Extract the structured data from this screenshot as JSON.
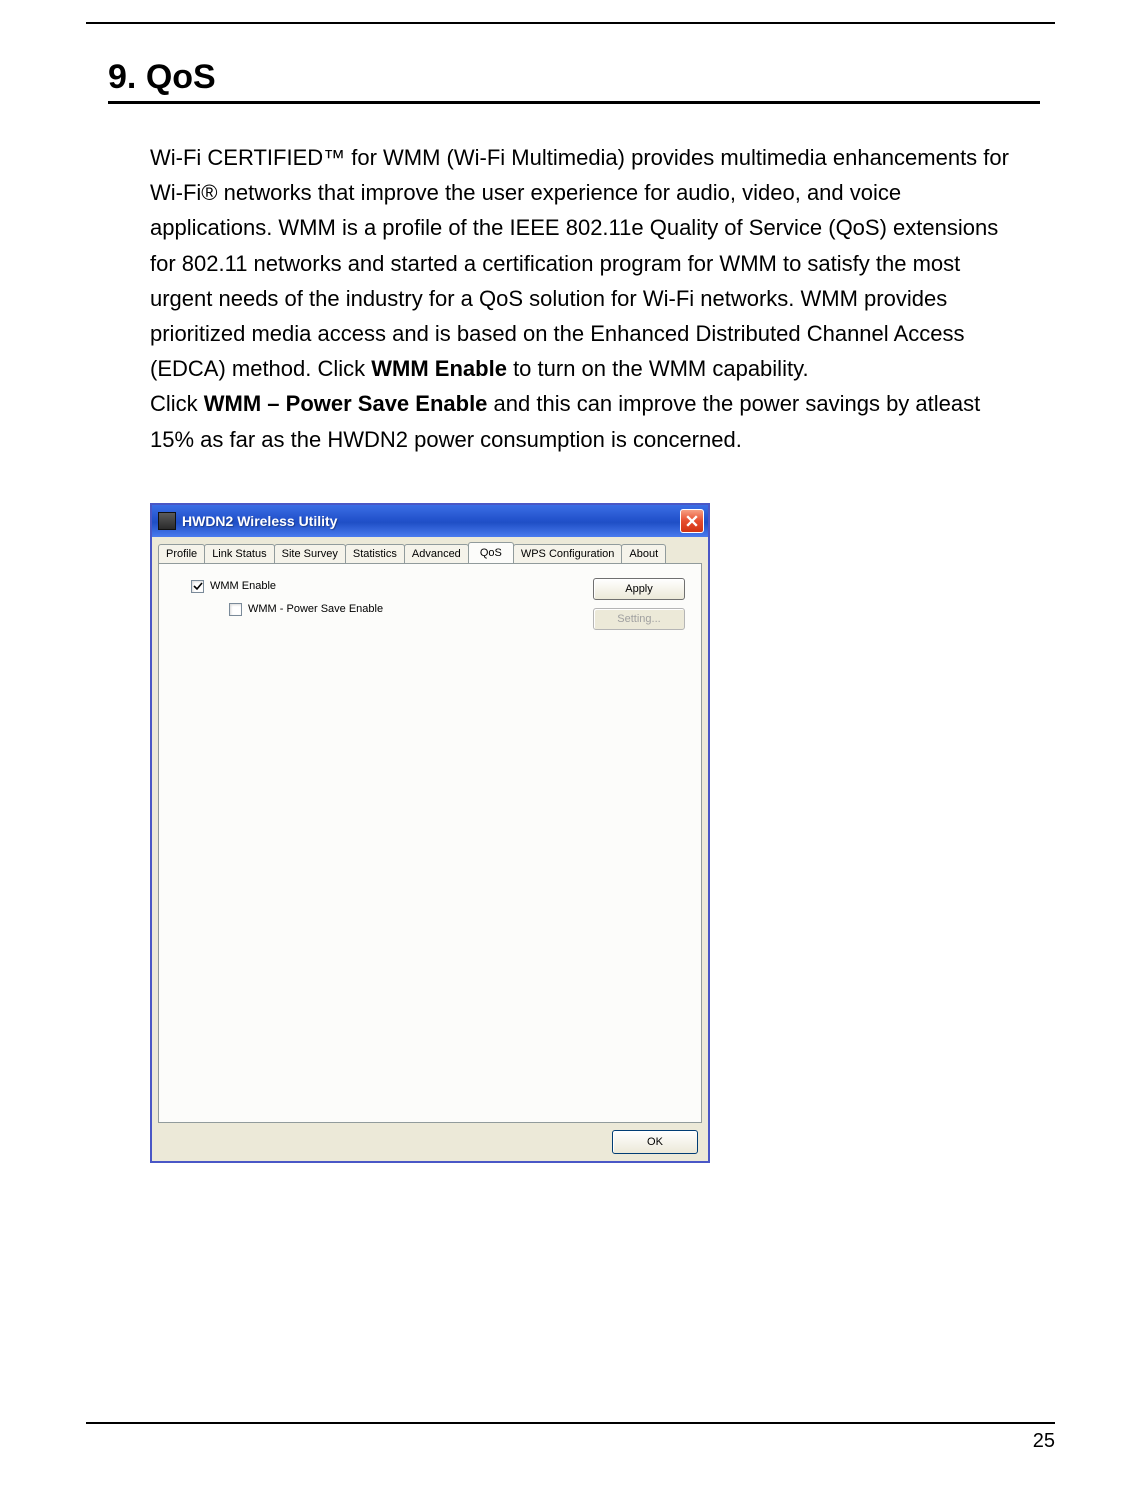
{
  "section": {
    "number": "9.",
    "title": "QoS"
  },
  "paragraphs": {
    "p1a": "Wi-Fi CERTIFIED™ for WMM (Wi-Fi Multimedia) provides multimedia enhancements for Wi-Fi® networks that improve the user experience for audio, video, and voice applications. WMM is a profile of the IEEE 802.11e Quality of Service (QoS) extensions for 802.11 networks and started a certification program for WMM to satisfy the most urgent needs of the industry for a QoS solution for Wi-Fi networks. WMM provides prioritized media access and is based on the Enhanced Distributed Channel Access (EDCA) method.   Click ",
    "p1bold1": "WMM Enable",
    "p1b": " to turn on the WMM capability.",
    "p2a": "Click ",
    "p2bold": "WMM – Power Save Enable",
    "p2b": " and this can improve the power savings by atleast 15% as far as the HWDN2  power consumption is concerned."
  },
  "dialog": {
    "title": "HWDN2 Wireless Utility",
    "tabs": [
      "Profile",
      "Link Status",
      "Site Survey",
      "Statistics",
      "Advanced",
      "QoS",
      "WPS Configuration",
      "About"
    ],
    "active_tab_index": 5,
    "wmm_enable_label": "WMM Enable",
    "wmm_enable_checked": true,
    "wmm_ps_label": "WMM - Power Save Enable",
    "wmm_ps_checked": false,
    "apply_label": "Apply",
    "setting_label": "Setting...",
    "ok_label": "OK"
  },
  "page_number": "25"
}
